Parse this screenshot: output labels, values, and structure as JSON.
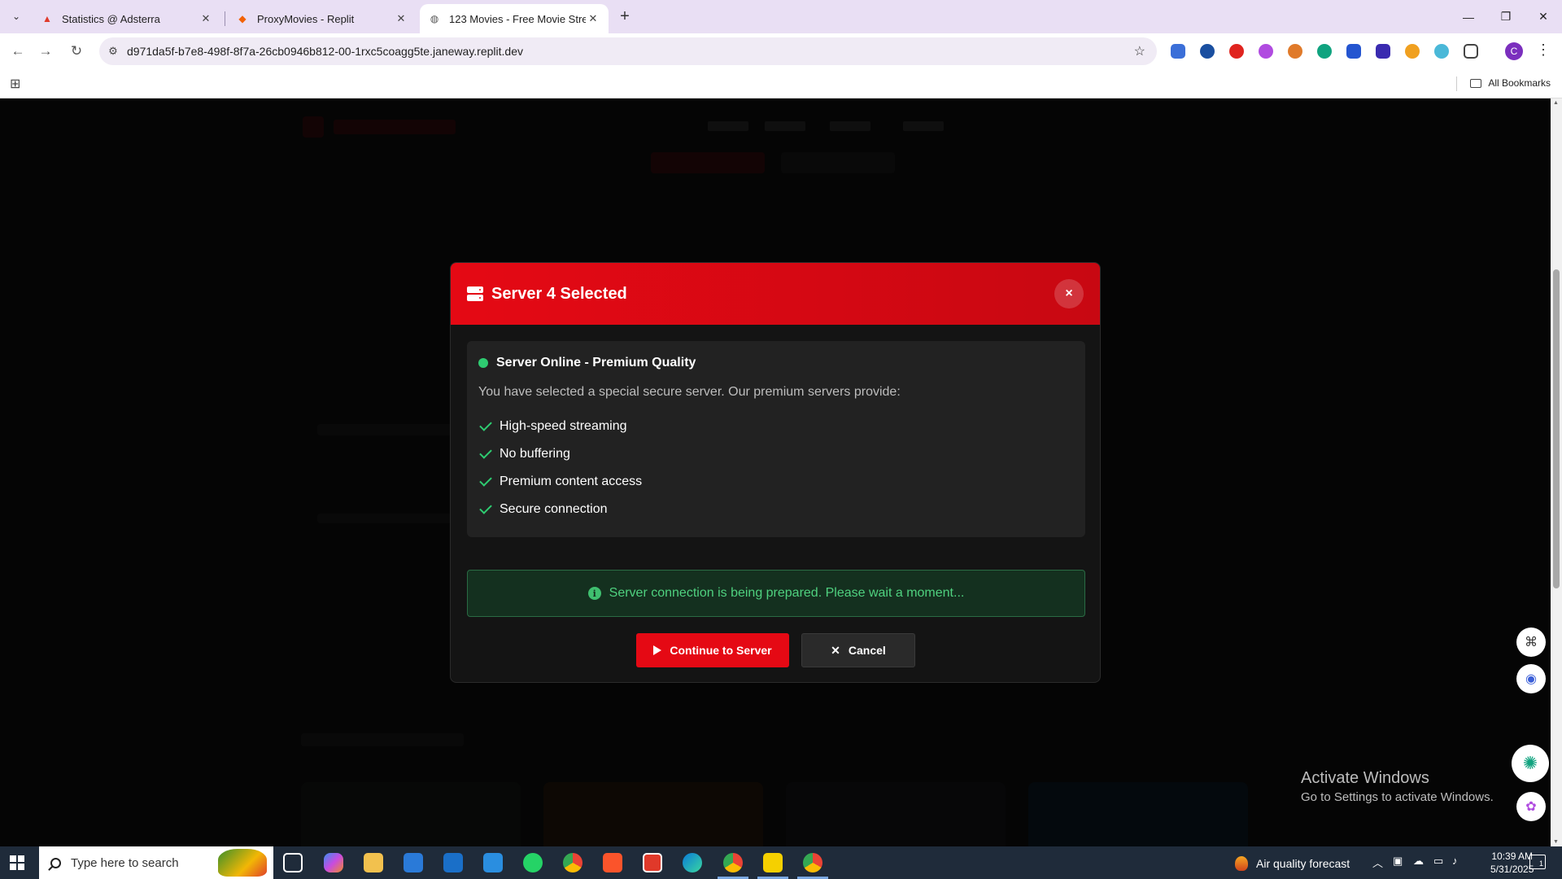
{
  "browser": {
    "tabs": [
      {
        "title": "Statistics @ Adsterra",
        "icon": "adsterra-icon",
        "active": false
      },
      {
        "title": "ProxyMovies - Replit",
        "icon": "replit-icon",
        "active": false
      },
      {
        "title": "123 Movies - Free Movie Strean",
        "icon": "globe-icon",
        "active": true
      }
    ],
    "url": "d971da5f-b7e8-498f-8f7a-26cb0946b812-00-1rxc5coagg5te.janeway.replit.dev",
    "profile_initial": "C",
    "all_bookmarks_label": "All Bookmarks"
  },
  "modal": {
    "title": "Server 4 Selected",
    "close_label": "×",
    "status": "Server Online - Premium Quality",
    "description": "You have selected a special secure server. Our premium servers provide:",
    "features": [
      "High-speed streaming",
      "No buffering",
      "Premium content access",
      "Secure connection"
    ],
    "notice": "Server connection is being prepared. Please wait a moment...",
    "continue_label": "Continue to Server",
    "cancel_label": "Cancel"
  },
  "watermark": {
    "line1": "Activate Windows",
    "line2": "Go to Settings to activate Windows."
  },
  "taskbar": {
    "search_placeholder": "Type here to search",
    "weather": "Air quality forecast",
    "time": "10:39 AM",
    "date": "5/31/2025",
    "notification_count": "1"
  },
  "colors": {
    "accent": "#e50914",
    "success": "#2ecc71"
  }
}
